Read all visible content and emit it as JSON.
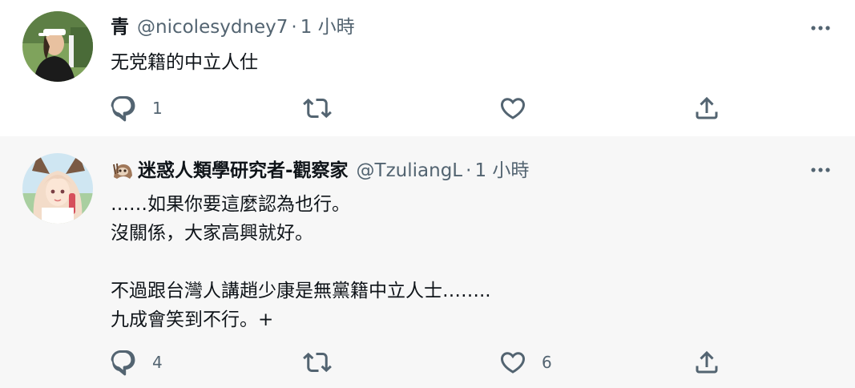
{
  "tweets": [
    {
      "name": "青",
      "handle": "@nicolesydney7",
      "separator": "·",
      "time": "1 小時",
      "text": "无党籍的中立人仕",
      "reply_count": "1",
      "retweet_count": "",
      "like_count": ""
    },
    {
      "name": "迷惑人類學研究者-觀察家",
      "handle": "@TzuliangL",
      "separator": "·",
      "time": "1 小時",
      "text": "……如果你要這麼認為也行。\n沒關係，大家高興就好。\n\n不過跟台灣人講趙少康是無黨籍中立人士……..\n九成會笑到不行。+",
      "reply_count": "4",
      "retweet_count": "",
      "like_count": "6"
    }
  ],
  "icons": {
    "reply": "reply-icon",
    "retweet": "retweet-icon",
    "like": "heart-icon",
    "share": "share-icon",
    "more": "more-icon"
  },
  "colors": {
    "icon_gray": "#536471",
    "thread_line": "#cfd9de",
    "highlight_bg": "#f7f7f7"
  }
}
